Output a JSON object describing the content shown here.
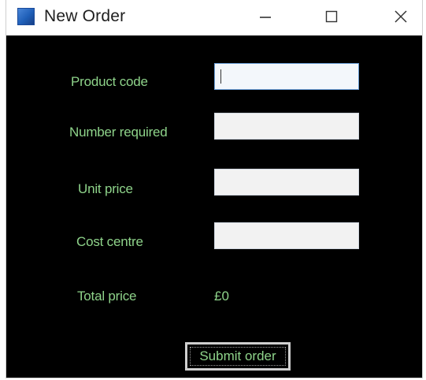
{
  "window": {
    "title": "New Order",
    "icon": "app-window-icon",
    "controls": {
      "minimize_icon": "minimize-icon",
      "maximize_icon": "maximize-icon",
      "close_icon": "close-icon"
    }
  },
  "form": {
    "product_code": {
      "label": "Product code",
      "value": "",
      "placeholder": ""
    },
    "number_required": {
      "label": "Number required",
      "value": "",
      "placeholder": ""
    },
    "unit_price": {
      "label": "Unit price",
      "value": "",
      "placeholder": ""
    },
    "cost_centre": {
      "label": "Cost centre",
      "value": "",
      "placeholder": ""
    },
    "total_price": {
      "label": "Total price",
      "value": "£0"
    },
    "submit_label": "Submit order"
  },
  "colors": {
    "background": "#000000",
    "label_text": "#8ed38a",
    "input_background": "#f2f2f2",
    "titlebar": "#ffffff"
  }
}
